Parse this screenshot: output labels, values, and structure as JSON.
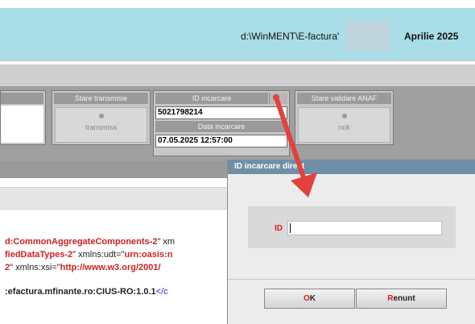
{
  "header": {
    "path": "d:\\WinMENT\\E-factura'",
    "period": "Aprilie 2025"
  },
  "panel": {
    "stare_transmisie": {
      "title": "Stare transmisie",
      "value": "transmisa"
    },
    "id_incarcare": {
      "title": "ID incarcare",
      "value": "5021798214"
    },
    "data_incarcare": {
      "title": "Data incarcare",
      "value": "07.05.2025 12:57:00"
    },
    "stare_validare": {
      "title": "Stare validare ANAF",
      "value": "nok"
    }
  },
  "code_lines": [
    {
      "red": "d:CommonAggregateComponents-2",
      "rest": "\" xm"
    },
    {
      "red": "fiedDataTypes-2",
      "rest": "\" xmlns:udt=\"",
      "red2": "urn:oasis:n"
    },
    {
      "red": "2",
      "rest": "\" xmlns:xsi=\"",
      "red2": "http://www.w3.org/2001/"
    },
    {
      "blk": ":efactura.mfinante.ro:CIUS-RO:1.0.1",
      "blue": "</c"
    }
  ],
  "dialog": {
    "title": "ID incarcare direct",
    "id_label": "ID",
    "id_value": "",
    "ok_hot": "O",
    "ok_rest": "K",
    "cancel_hot": "R",
    "cancel_rest": "enunt"
  },
  "colors": {
    "header_bg": "#a9dde7",
    "dialog_title_bg": "#6f8fa6",
    "arrow": "#e2413d"
  },
  "icons": {
    "arrow": "red-arrow-annotation"
  }
}
